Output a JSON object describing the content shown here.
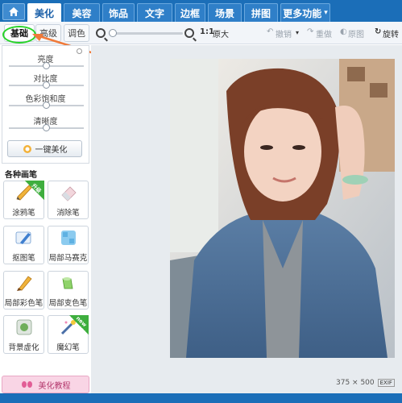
{
  "top_tabs": [
    {
      "label": "美化",
      "active": true
    },
    {
      "label": "美容",
      "active": false
    },
    {
      "label": "饰品",
      "active": false
    },
    {
      "label": "文字",
      "active": false
    },
    {
      "label": "边框",
      "active": false
    },
    {
      "label": "场景",
      "active": false
    },
    {
      "label": "拼图",
      "active": false
    },
    {
      "label": "更多功能",
      "active": false,
      "dropdown": true
    }
  ],
  "sub_tabs": [
    {
      "label": "基础",
      "active": true
    },
    {
      "label": "高级",
      "active": false
    },
    {
      "label": "调色",
      "active": false
    }
  ],
  "toolbar": {
    "original_size_label": "原大",
    "undo_label": "撤销",
    "redo_label": "重做",
    "original_image_label": "原图",
    "rotate_label": "旋转"
  },
  "adjustments": [
    {
      "label": "亮度",
      "value": 0.5
    },
    {
      "label": "对比度",
      "value": 0.5
    },
    {
      "label": "色彩饱和度",
      "value": 0.5
    },
    {
      "label": "清晰度",
      "value": 0.5
    }
  ],
  "one_key_button": "一键美化",
  "brushes_title": "各种画笔",
  "brushes": [
    {
      "label": "涂鸦笔",
      "icon": "pencil-icon",
      "badge": "升级"
    },
    {
      "label": "消除笔",
      "icon": "eraser-icon",
      "badge": ""
    },
    {
      "label": "抠图笔",
      "icon": "cutout-pen-icon",
      "badge": ""
    },
    {
      "label": "局部马赛克",
      "icon": "mosaic-icon",
      "badge": ""
    },
    {
      "label": "局部彩色笔",
      "icon": "color-brush-icon",
      "badge": ""
    },
    {
      "label": "局部变色笔",
      "icon": "paint-bucket-icon",
      "badge": ""
    },
    {
      "label": "背景虚化",
      "icon": "blur-background-icon",
      "badge": ""
    },
    {
      "label": "魔幻笔",
      "icon": "magic-wand-icon",
      "badge": "new"
    }
  ],
  "tutorial_button": "美化教程",
  "status": {
    "dimensions": "375 × 500",
    "exif": "EXIF"
  },
  "colors": {
    "brand_blue": "#1b6eb8",
    "highlight_green": "#27d327",
    "arrow_orange": "#f07a3a"
  }
}
